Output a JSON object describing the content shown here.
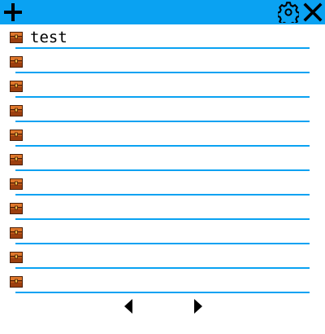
{
  "toolbar": {
    "add_icon": "plus-icon",
    "settings_icon": "gear-icon",
    "close_icon": "close-icon",
    "bar_color": "#0aa2f2"
  },
  "list": {
    "item_icon": "chest-icon",
    "rule_color": "#0aa2f2",
    "items": [
      {
        "label": "test"
      },
      {
        "label": ""
      },
      {
        "label": ""
      },
      {
        "label": ""
      },
      {
        "label": ""
      },
      {
        "label": ""
      },
      {
        "label": ""
      },
      {
        "label": ""
      },
      {
        "label": ""
      },
      {
        "label": ""
      },
      {
        "label": ""
      }
    ]
  },
  "pager": {
    "prev_icon": "triangle-left-icon",
    "next_icon": "triangle-right-icon"
  }
}
